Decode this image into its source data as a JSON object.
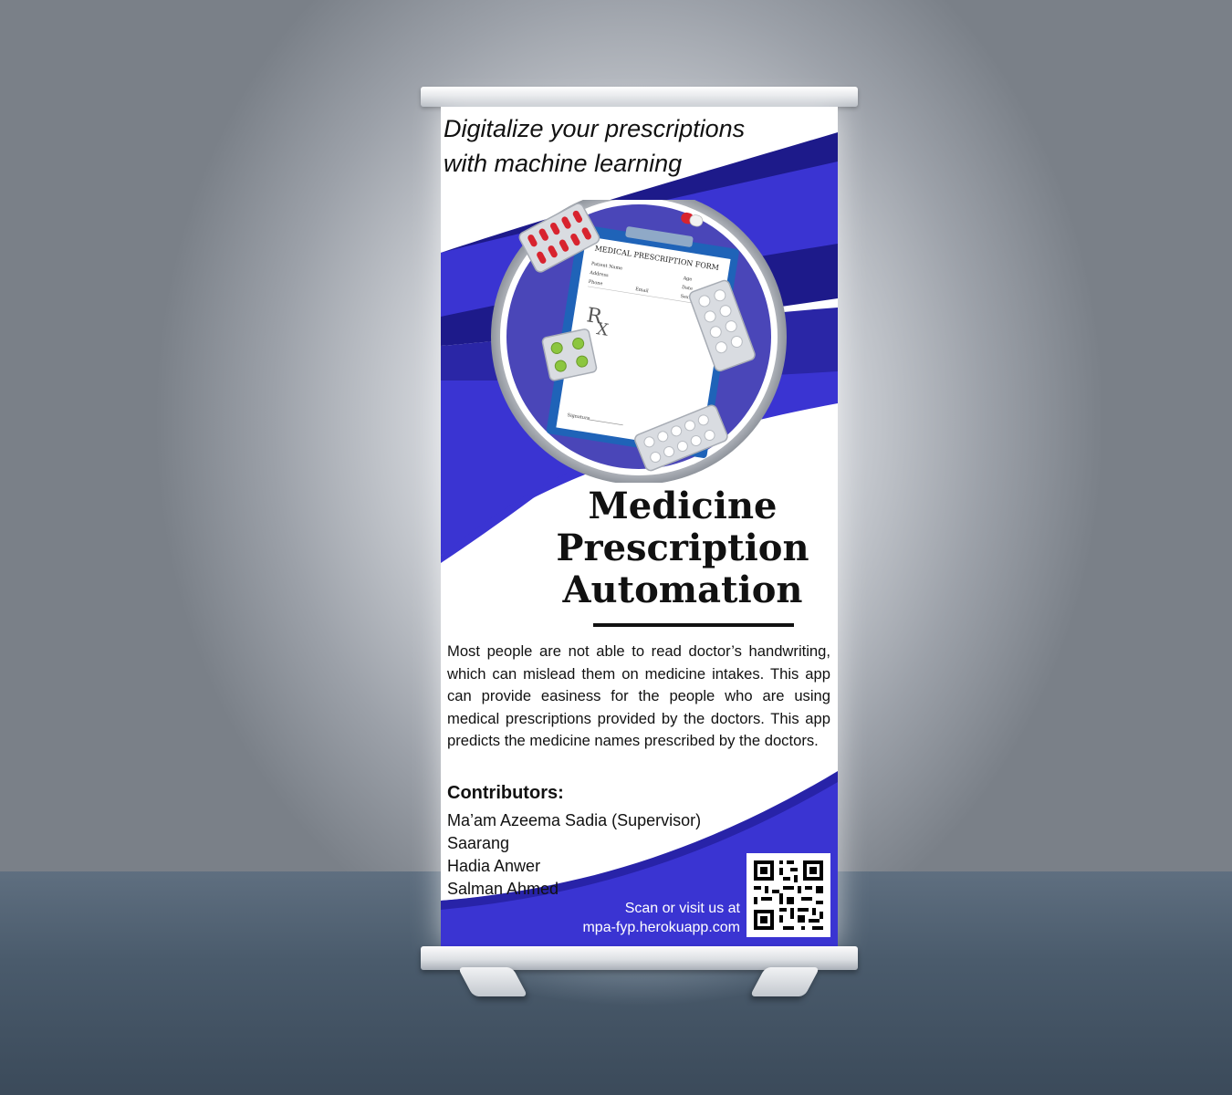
{
  "banner": {
    "tagline": [
      "Digitalize your prescriptions",
      "with machine learning"
    ],
    "title_line1": "Medicine",
    "title_line2": "Prescription",
    "title_line3": "Automation",
    "description": "Most people are not able to read doctor’s handwriting, which can mislead them on medicine intakes. This app can provide easiness for the people who are using medical prescriptions provided by the doctors. This app predicts the medicine names prescribed by the doctors.",
    "contributors_heading": "Contributors:",
    "contributors": [
      "Ma’am Azeema Sadia (Supervisor)",
      "Saarang",
      "Hadia Anwer",
      "Salman Ahmed"
    ],
    "visit_line1": "Scan or visit us at",
    "visit_line2": "mpa-fyp.herokuapp.com"
  },
  "illustration": {
    "form_title": "MEDICAL PRESCRIPTION FORM",
    "patient_name": "Patient Name",
    "age": "Age",
    "address": "Address",
    "date": "Date",
    "phone": "Phone",
    "email": "Email",
    "sex": "Sex",
    "rx": "R",
    "rx_sub": "X",
    "signature": "Signature"
  },
  "colors": {
    "brand_blue": "#3a34d2",
    "navy": "#1d1a8a",
    "emblem_fill": "#4a46b8",
    "clipboard": "#1f63b8"
  },
  "icons": [
    "prescription-clipboard-icon",
    "red-capsule-pack-icon",
    "capsule-icon",
    "white-tablet-pack-icon",
    "green-tablet-pack-icon",
    "qr-code-icon"
  ]
}
